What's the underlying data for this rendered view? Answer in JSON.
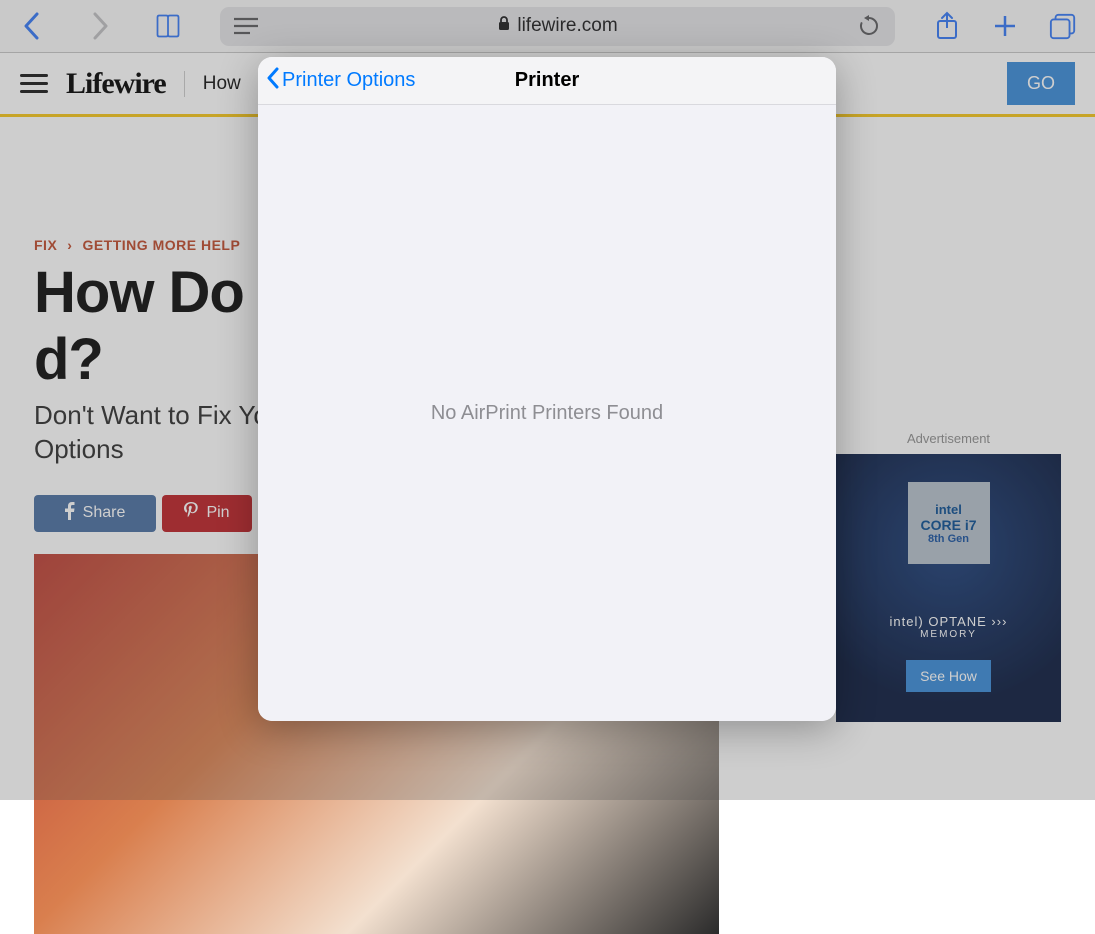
{
  "safari": {
    "url_host": "lifewire.com"
  },
  "navbar": {
    "logo": "Lifewire",
    "section_prefix": "How",
    "go_label": "GO"
  },
  "breadcrumbs": {
    "item1": "FIX",
    "item2": "GETTING MORE HELP"
  },
  "article": {
    "title_visible": "How Do I",
    "title_trailing": "d?",
    "subtitle_line1": "Don't Want to Fix Yo",
    "subtitle_line2": "Options"
  },
  "share": {
    "fb": "Share",
    "pin": "Pin"
  },
  "ad": {
    "label": "Advertisement",
    "chip_l1": "intel",
    "chip_l2": "CORE i7",
    "chip_l3": "8th Gen",
    "brand_line": "intel) OPTANE ›››",
    "brand_sub": "MEMORY",
    "cta": "See How"
  },
  "popover": {
    "back_label": "Printer Options",
    "title": "Printer",
    "body_message": "No AirPrint Printers Found"
  }
}
